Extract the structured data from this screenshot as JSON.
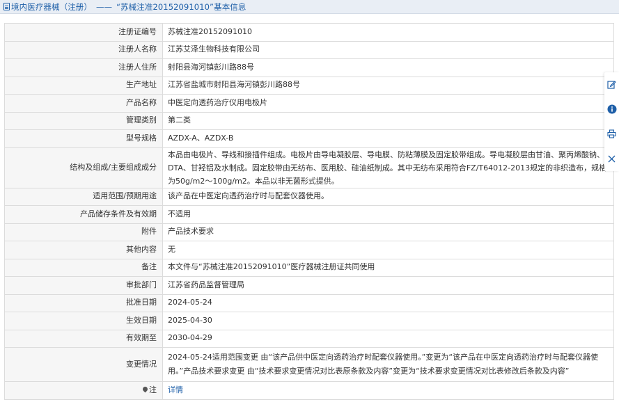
{
  "header": {
    "breadcrumb_main": "境内医疗器械（注册）",
    "separator": "——",
    "registration_title": "“苏械注准20152091010”基本信息"
  },
  "rows": [
    {
      "label": "注册证编号",
      "value": "苏械注准20152091010"
    },
    {
      "label": "注册人名称",
      "value": "江苏艾泽生物科技有限公司"
    },
    {
      "label": "注册人住所",
      "value": "射阳县海河镇彭川路88号"
    },
    {
      "label": "生产地址",
      "value": "江苏省盐城市射阳县海河镇彭川路88号"
    },
    {
      "label": "产品名称",
      "value": "中医定向透药治疗仪用电极片"
    },
    {
      "label": "管理类别",
      "value": "第二类"
    },
    {
      "label": "型号规格",
      "value": "AZDX-A、AZDX-B"
    },
    {
      "label": "结构及组成/主要组成成分",
      "value": "本品由电极片、导线和接插件组成。电极片由导电凝胶层、导电膜、防粘薄膜及固定胶带组成。导电凝胶层由甘油、聚丙烯酸钠、EDTA、甘羟铝及水制成。固定胶带由无纺布、医用胶、硅油纸制成。其中无纺布采用符合FZ/T64012-2013规定的非织造布，规格为50g/m2～100g/m2。本品以非无菌形式提供。"
    },
    {
      "label": "适用范围/预期用途",
      "value": "该产品在中医定向透药治疗时与配套仪器使用。"
    },
    {
      "label": "产品储存条件及有效期",
      "value": "不适用"
    },
    {
      "label": "附件",
      "value": "产品技术要求"
    },
    {
      "label": "其他内容",
      "value": "无"
    },
    {
      "label": "备注",
      "value": "本文件与“苏械注准20152091010”医疗器械注册证共同使用"
    },
    {
      "label": "审批部门",
      "value": "江苏省药品监督管理局"
    },
    {
      "label": "批准日期",
      "value": "2024-05-24"
    },
    {
      "label": "生效日期",
      "value": "2025-04-30"
    },
    {
      "label": "有效期至",
      "value": "2030-04-29"
    },
    {
      "label": "变更情况",
      "value": "2024-05-24适用范围变更 由“该产品供中医定向透药治疗时配套仪器使用。”变更为“该产品在中医定向透药治疗时与配套仪器使用。”产品技术要求变更 由“技术要求变更情况对比表原条款及内容”变更为“技术要求变更情况对比表修改后条款及内容”"
    }
  ],
  "note_row": {
    "label": "注",
    "link_text": "详情"
  },
  "toolbar": {
    "icons": [
      "edit-icon",
      "info-icon",
      "print-icon",
      "close-icon"
    ],
    "accent": "#1e5fa8"
  }
}
